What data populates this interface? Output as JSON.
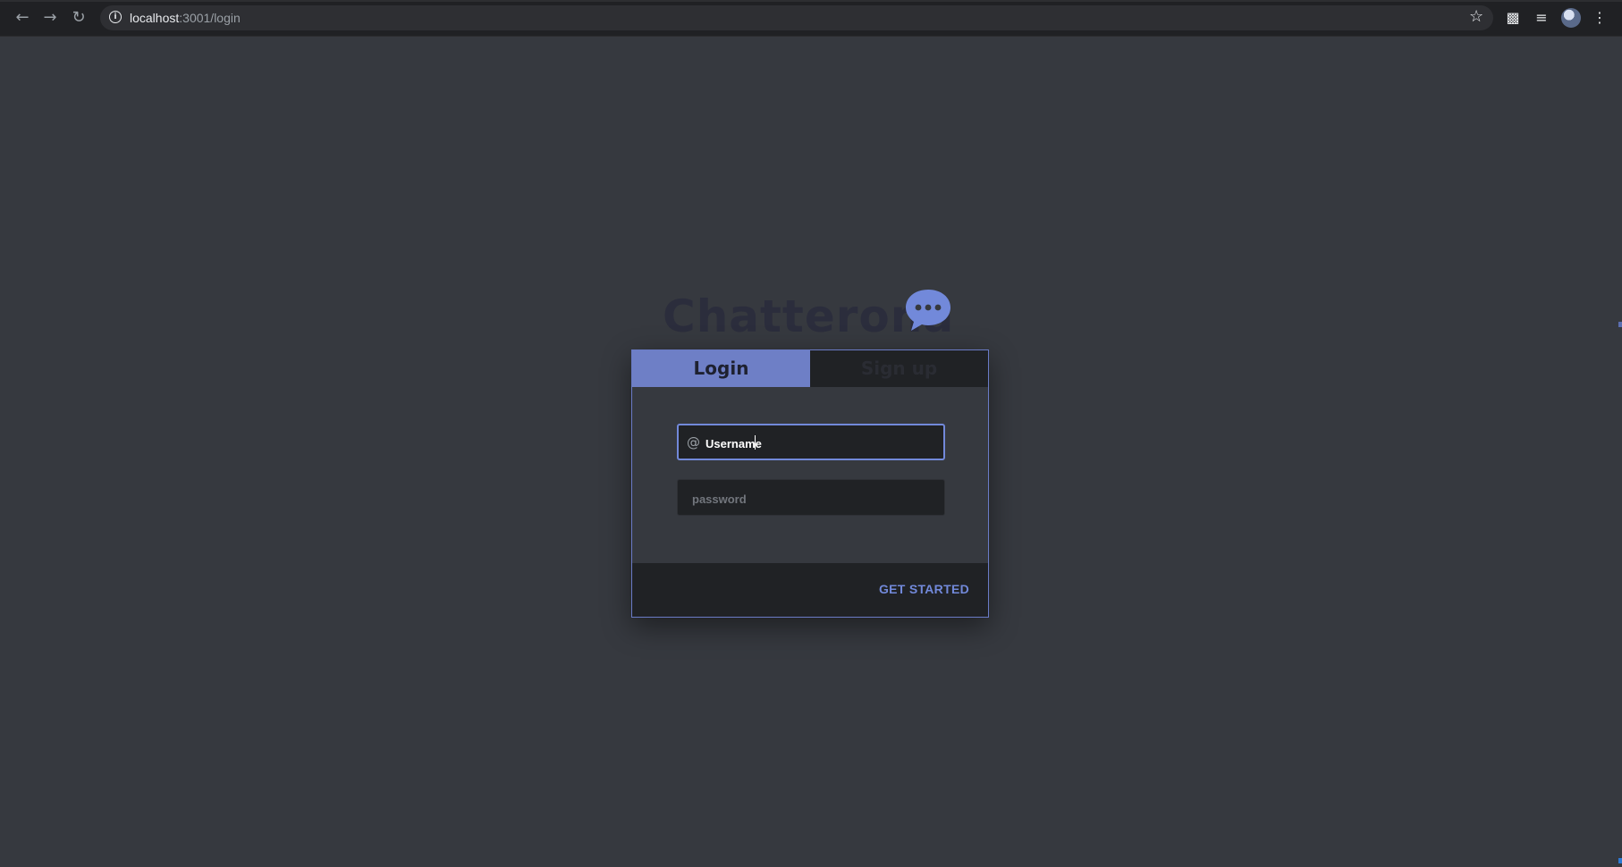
{
  "browser": {
    "back_icon": "arrow-left-icon",
    "forward_icon": "arrow-right-icon",
    "reload_icon": "reload-icon",
    "url_host": "localhost",
    "url_rest": ":3001/login",
    "bookmark_icon": "star-icon",
    "extensions_icon": "puzzle-icon",
    "media_icon": "playlist-icon",
    "menu_icon": "kebab-menu-icon"
  },
  "app": {
    "title": "Chatterona",
    "logo_icon": "chat-bubble-icon"
  },
  "auth": {
    "tabs": [
      {
        "label": "Login",
        "active": true
      },
      {
        "label": "Sign up",
        "active": false
      }
    ],
    "username": {
      "value": "Username",
      "prefix": "@"
    },
    "password": {
      "placeholder": "password",
      "value": ""
    },
    "submit_label": "GET STARTED"
  },
  "colors": {
    "background": "#36393f",
    "accent": "#7289da",
    "tab_active": "#6e7fc6",
    "dark_panel": "#202225"
  }
}
